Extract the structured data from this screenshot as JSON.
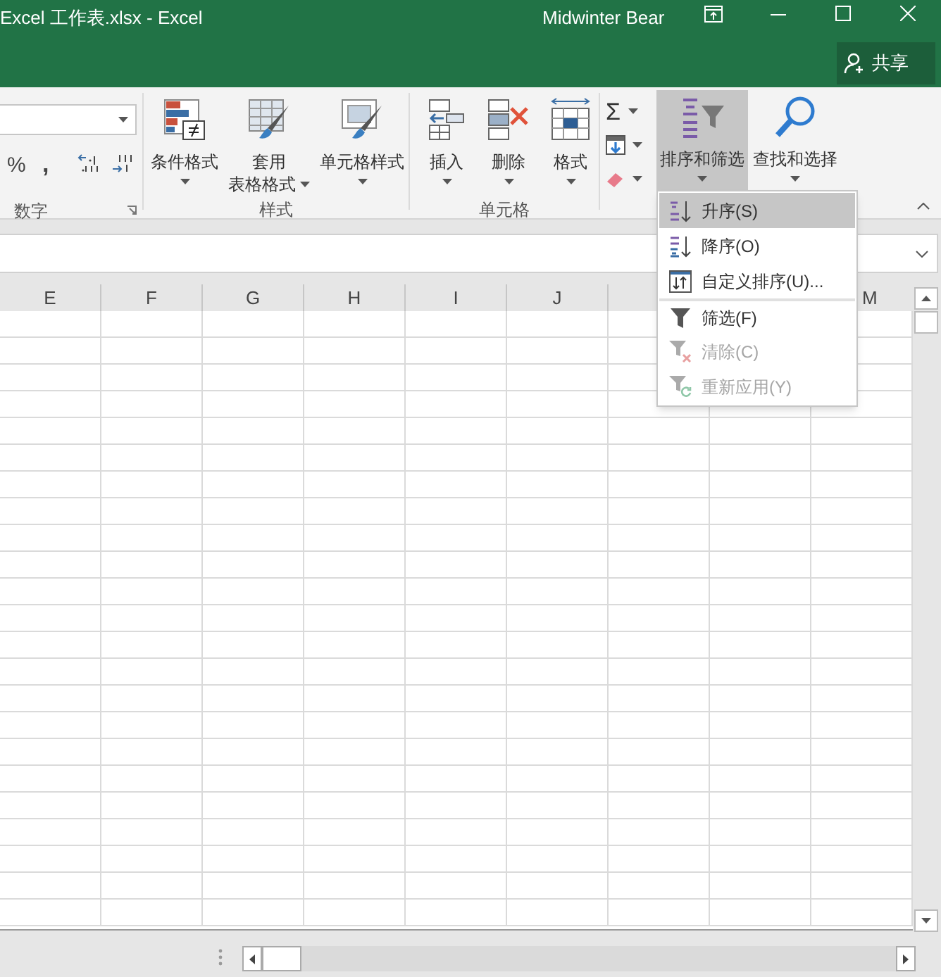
{
  "window": {
    "title": "Excel 工作表.xlsx  -  Excel",
    "user": "Midwinter Bear",
    "share": "共享"
  },
  "ribbon": {
    "number_group": {
      "label": "数字",
      "percent": "%",
      "comma": ","
    },
    "styles_group": {
      "label": "样式",
      "buttons": [
        {
          "label": "条件格式",
          "kind": "conditional"
        },
        {
          "label": "套用",
          "label2": "表格格式",
          "kind": "table"
        },
        {
          "label": "单元格样式",
          "kind": "cellstyle"
        }
      ]
    },
    "cells_group": {
      "label": "单元格",
      "buttons": [
        {
          "label": "插入",
          "kind": "insert"
        },
        {
          "label": "删除",
          "kind": "delete"
        },
        {
          "label": "格式",
          "kind": "format"
        }
      ]
    },
    "editing_group": {
      "sum": "Σ",
      "buttons": [
        {
          "label": "排序和筛选",
          "kind": "sort",
          "expanded": true
        },
        {
          "label": "查找和选择",
          "kind": "find",
          "expanded": false
        }
      ]
    }
  },
  "sheet": {
    "columns": [
      "E",
      "F",
      "G",
      "H",
      "I",
      "J"
    ],
    "last_column": "M"
  },
  "sort_menu": {
    "items": [
      {
        "label": "升序(S)",
        "kind": "asc",
        "selected": true,
        "disabled": false,
        "separator_before": false
      },
      {
        "label": "降序(O)",
        "kind": "desc",
        "selected": false,
        "disabled": false,
        "separator_before": false
      },
      {
        "label": "自定义排序(U)...",
        "kind": "custom",
        "selected": false,
        "disabled": false,
        "separator_before": false
      },
      {
        "label": "筛选(F)",
        "kind": "filter",
        "selected": false,
        "disabled": false,
        "separator_before": true
      },
      {
        "label": "清除(C)",
        "kind": "clear",
        "selected": false,
        "disabled": true,
        "separator_before": false
      },
      {
        "label": "重新应用(Y)",
        "kind": "reapply",
        "selected": false,
        "disabled": true,
        "separator_before": false
      }
    ]
  }
}
